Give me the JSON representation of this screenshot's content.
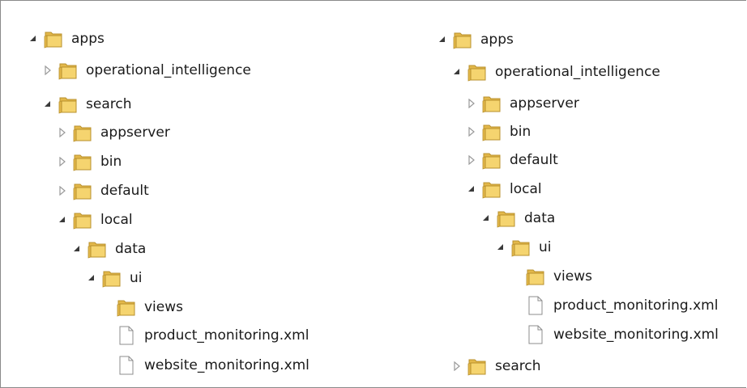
{
  "left_tree": [
    {
      "label": "apps",
      "type": "folder",
      "state": "expanded",
      "depth": 0
    },
    {
      "label": "operational_intelligence",
      "type": "folder",
      "state": "collapsed",
      "depth": 1
    },
    {
      "label": "search",
      "type": "folder",
      "state": "expanded",
      "depth": 1
    },
    {
      "label": "appserver",
      "type": "folder",
      "state": "collapsed",
      "depth": 2
    },
    {
      "label": "bin",
      "type": "folder",
      "state": "collapsed",
      "depth": 2
    },
    {
      "label": "default",
      "type": "folder",
      "state": "collapsed",
      "depth": 2
    },
    {
      "label": "local",
      "type": "folder",
      "state": "expanded",
      "depth": 2
    },
    {
      "label": "data",
      "type": "folder",
      "state": "expanded",
      "depth": 3
    },
    {
      "label": "ui",
      "type": "folder",
      "state": "expanded",
      "depth": 4
    },
    {
      "label": "views",
      "type": "folder",
      "state": "none",
      "depth": 5
    },
    {
      "label": "product_monitoring.xml",
      "type": "file",
      "state": "none",
      "depth": 6
    },
    {
      "label": "website_monitoring.xml",
      "type": "file",
      "state": "none",
      "depth": 6
    }
  ],
  "right_tree": [
    {
      "label": "apps",
      "type": "folder",
      "state": "expanded",
      "depth": 0
    },
    {
      "label": "operational_intelligence",
      "type": "folder",
      "state": "expanded",
      "depth": 1
    },
    {
      "label": "appserver",
      "type": "folder",
      "state": "collapsed",
      "depth": 2
    },
    {
      "label": "bin",
      "type": "folder",
      "state": "collapsed",
      "depth": 2
    },
    {
      "label": "default",
      "type": "folder",
      "state": "collapsed",
      "depth": 2
    },
    {
      "label": "local",
      "type": "folder",
      "state": "expanded",
      "depth": 2
    },
    {
      "label": "data",
      "type": "folder",
      "state": "expanded",
      "depth": 3
    },
    {
      "label": "ui",
      "type": "folder",
      "state": "expanded",
      "depth": 4
    },
    {
      "label": "views",
      "type": "folder",
      "state": "none",
      "depth": 5
    },
    {
      "label": "product_monitoring.xml",
      "type": "file",
      "state": "none",
      "depth": 6
    },
    {
      "label": "website_monitoring.xml",
      "type": "file",
      "state": "none",
      "depth": 6
    },
    {
      "label": "search",
      "type": "folder",
      "state": "collapsed",
      "depth": 1
    }
  ],
  "icons": {
    "folder": "folder-icon",
    "file": "file-icon",
    "expanded": "expanded-triangle-icon",
    "collapsed": "collapsed-triangle-icon"
  },
  "colors": {
    "folder_front": "#f5d46f",
    "folder_back": "#e3b84a",
    "folder_edge": "#b8902c",
    "arrow_expanded": "#3a3a3a",
    "arrow_collapsed": "#9a9a9a",
    "file_edge": "#8c8c8c"
  }
}
